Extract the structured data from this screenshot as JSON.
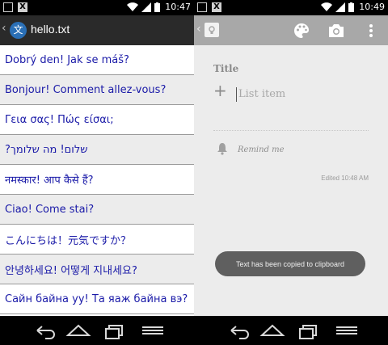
{
  "left": {
    "status": {
      "time": "10:47"
    },
    "app_title": "hello.txt",
    "logo_char": "文",
    "lines": [
      {
        "text": "Dobrý den! Jak se máš?"
      },
      {
        "text": "Bonjour! Comment allez-vous?"
      },
      {
        "text": "Γεια σας! Πώς είσαι;"
      },
      {
        "text": "שלום! מה שלומך?"
      },
      {
        "text": "नमस्कार! आप कैसे हैं?"
      },
      {
        "text": "Ciao! Come stai?"
      },
      {
        "text": "こんにちは！元気ですか？"
      },
      {
        "text": "안녕하세요! 어떻게 지내세요?"
      },
      {
        "text": "Сайн байна уу! Та яаж байна вэ?"
      }
    ]
  },
  "right": {
    "status": {
      "time": "10:49"
    },
    "note": {
      "title_placeholder": "Title",
      "list_item_placeholder": "List item",
      "remind_me": "Remind me",
      "edited": "Edited 10:48 AM"
    },
    "toast": "Text has been copied to clipboard"
  },
  "colors": {
    "link_blue": "#1a1aa8",
    "left_actionbar": "#2a2a2a",
    "right_actionbar": "#a8a8a8",
    "toast_bg": "#5f5f5f"
  },
  "icons": [
    "back-chevron-icon",
    "translate-logo-icon",
    "keep-app-icon",
    "palette-icon",
    "camera-icon",
    "overflow-menu-icon",
    "plus-icon",
    "bell-icon",
    "nav-back-icon",
    "nav-home-icon",
    "nav-recents-icon",
    "nav-menu-icon",
    "wifi-icon",
    "signal-icon",
    "battery-icon"
  ]
}
